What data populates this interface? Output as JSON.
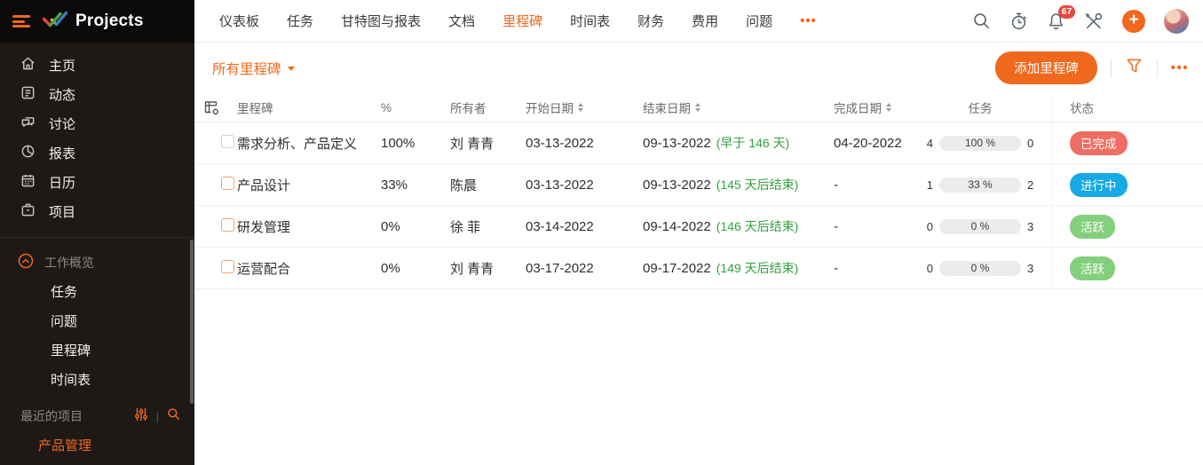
{
  "brand": {
    "product_name": "Projects"
  },
  "topnav": {
    "tabs": [
      {
        "label": "仪表板",
        "active": false
      },
      {
        "label": "任务",
        "active": false
      },
      {
        "label": "甘特图与报表",
        "active": false
      },
      {
        "label": "文档",
        "active": false
      },
      {
        "label": "里程碑",
        "active": true
      },
      {
        "label": "时间表",
        "active": false
      },
      {
        "label": "财务",
        "active": false
      },
      {
        "label": "费用",
        "active": false
      },
      {
        "label": "问题",
        "active": false
      }
    ],
    "more_label": "•••",
    "notification_count": "67"
  },
  "sidebar": {
    "main_items": [
      {
        "label": "主页"
      },
      {
        "label": "动态"
      },
      {
        "label": "讨论"
      },
      {
        "label": "报表"
      },
      {
        "label": "日历"
      },
      {
        "label": "项目"
      }
    ],
    "work_section_label": "工作概览",
    "work_items": [
      "任务",
      "问题",
      "里程碑",
      "时间表"
    ],
    "recent_label": "最近的项目",
    "recent_projects": [
      {
        "label": "产品管理"
      }
    ]
  },
  "toolbar": {
    "view_selector": "所有里程碑",
    "add_button": "添加里程碑",
    "more_label": "•••"
  },
  "table": {
    "headers": [
      {
        "label": "里程碑",
        "sortable": false
      },
      {
        "label": "%",
        "sortable": false
      },
      {
        "label": "所有者",
        "sortable": false
      },
      {
        "label": "开始日期",
        "sortable": true
      },
      {
        "label": "结束日期",
        "sortable": true
      },
      {
        "label": "完成日期",
        "sortable": true
      },
      {
        "label": "任务",
        "sortable": false
      },
      {
        "label": "状态",
        "sortable": false
      }
    ],
    "rows": [
      {
        "name": "需求分析、产品定义",
        "percent": "100%",
        "owner": "刘 青青",
        "start": "03-13-2022",
        "end": "09-13-2022",
        "end_note": "(早于 146 天)",
        "completed": "04-20-2022",
        "tasks_open": "4",
        "tasks_closed": "0",
        "progress": 100,
        "progress_label": "100 %",
        "status": "已完成",
        "status_color": "#ee6e63",
        "checkbox_muted": true
      },
      {
        "name": "产品设计",
        "percent": "33%",
        "owner": "陈晨",
        "start": "03-13-2022",
        "end": "09-13-2022",
        "end_note": "(145 天后结束)",
        "completed": "-",
        "tasks_open": "1",
        "tasks_closed": "2",
        "progress": 33,
        "progress_label": "33 %",
        "status": "进行中",
        "status_color": "#16a9e4",
        "checkbox_muted": false
      },
      {
        "name": "研发管理",
        "percent": "0%",
        "owner": "徐 菲",
        "start": "03-14-2022",
        "end": "09-14-2022",
        "end_note": "(146 天后结束)",
        "completed": "-",
        "tasks_open": "0",
        "tasks_closed": "3",
        "progress": 0,
        "progress_label": "0 %",
        "status": "活跃",
        "status_color": "#84cf7d",
        "checkbox_muted": false
      },
      {
        "name": "运营配合",
        "percent": "0%",
        "owner": "刘 青青",
        "start": "03-17-2022",
        "end": "09-17-2022",
        "end_note": "(149 天后结束)",
        "completed": "-",
        "tasks_open": "0",
        "tasks_closed": "3",
        "progress": 0,
        "progress_label": "0 %",
        "status": "活跃",
        "status_color": "#84cf7d",
        "checkbox_muted": false
      }
    ]
  },
  "colors": {
    "accent": "#f0681c",
    "status_completed": "#ee6e63",
    "status_in_progress": "#16a9e4",
    "status_active": "#84cf7d",
    "green_text": "#2fa33c",
    "progress_fill": "#8ed07f",
    "notification_badge": "#e8483c"
  }
}
